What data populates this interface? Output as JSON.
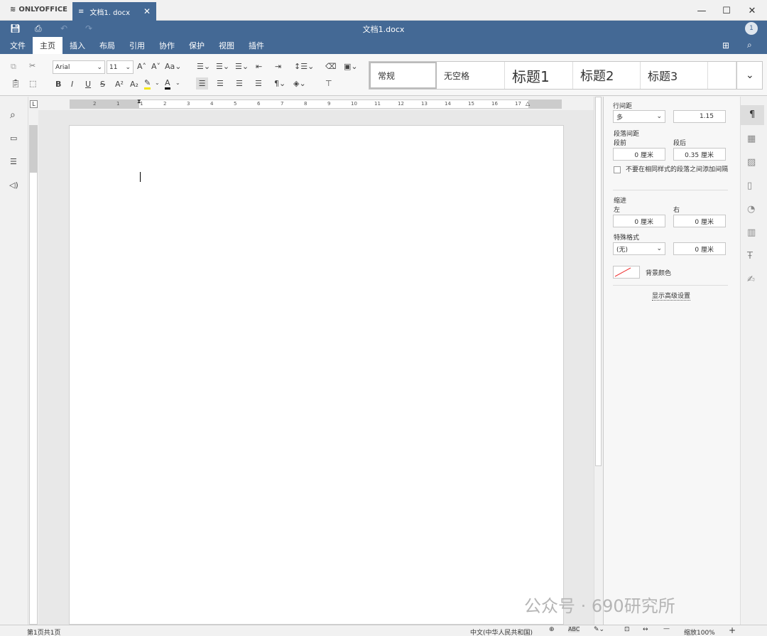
{
  "app": {
    "logo_text": "ONLYOFFICE",
    "tab_title": "文档1. docx",
    "doc_title": "文档1.docx",
    "user_badge": "1"
  },
  "menu": {
    "tabs": [
      "文件",
      "主页",
      "插入",
      "布局",
      "引用",
      "协作",
      "保护",
      "视图",
      "插件"
    ],
    "active": "主页"
  },
  "toolbar": {
    "font_name": "Arial",
    "font_size": "11",
    "styles": [
      "常规",
      "无空格",
      "标题1",
      "标题2",
      "标题3"
    ]
  },
  "ruler": {
    "h_ticks": [
      "2",
      "1",
      "1",
      "2",
      "3",
      "4",
      "5",
      "6",
      "7",
      "8",
      "9",
      "10",
      "11",
      "12",
      "13",
      "14",
      "15",
      "16",
      "17"
    ]
  },
  "panel": {
    "line_spacing_label": "行间距",
    "line_spacing_mode": "多",
    "line_spacing_value": "1.15",
    "para_spacing_label": "段落间距",
    "before_label": "段前",
    "after_label": "段后",
    "before_value": "0 厘米",
    "after_value": "0.35 厘米",
    "no_space_checkbox": "不要在相同样式的段落之间添加间隔",
    "indent_label": "缩进",
    "left_label": "左",
    "right_label": "右",
    "left_value": "0 厘米",
    "right_value": "0 厘米",
    "special_label": "特殊格式",
    "special_mode": "(无)",
    "special_value": "0 厘米",
    "bg_color_label": "背景颜色",
    "advanced_link": "显示高级设置"
  },
  "status": {
    "page_info": "第1页共1页",
    "language": "中文(中华人民共和国)",
    "zoom": "缩放100%"
  },
  "watermark": "公众号 · 690研究所",
  "colors": {
    "brand": "#446995",
    "panel": "#f7f7f7"
  }
}
